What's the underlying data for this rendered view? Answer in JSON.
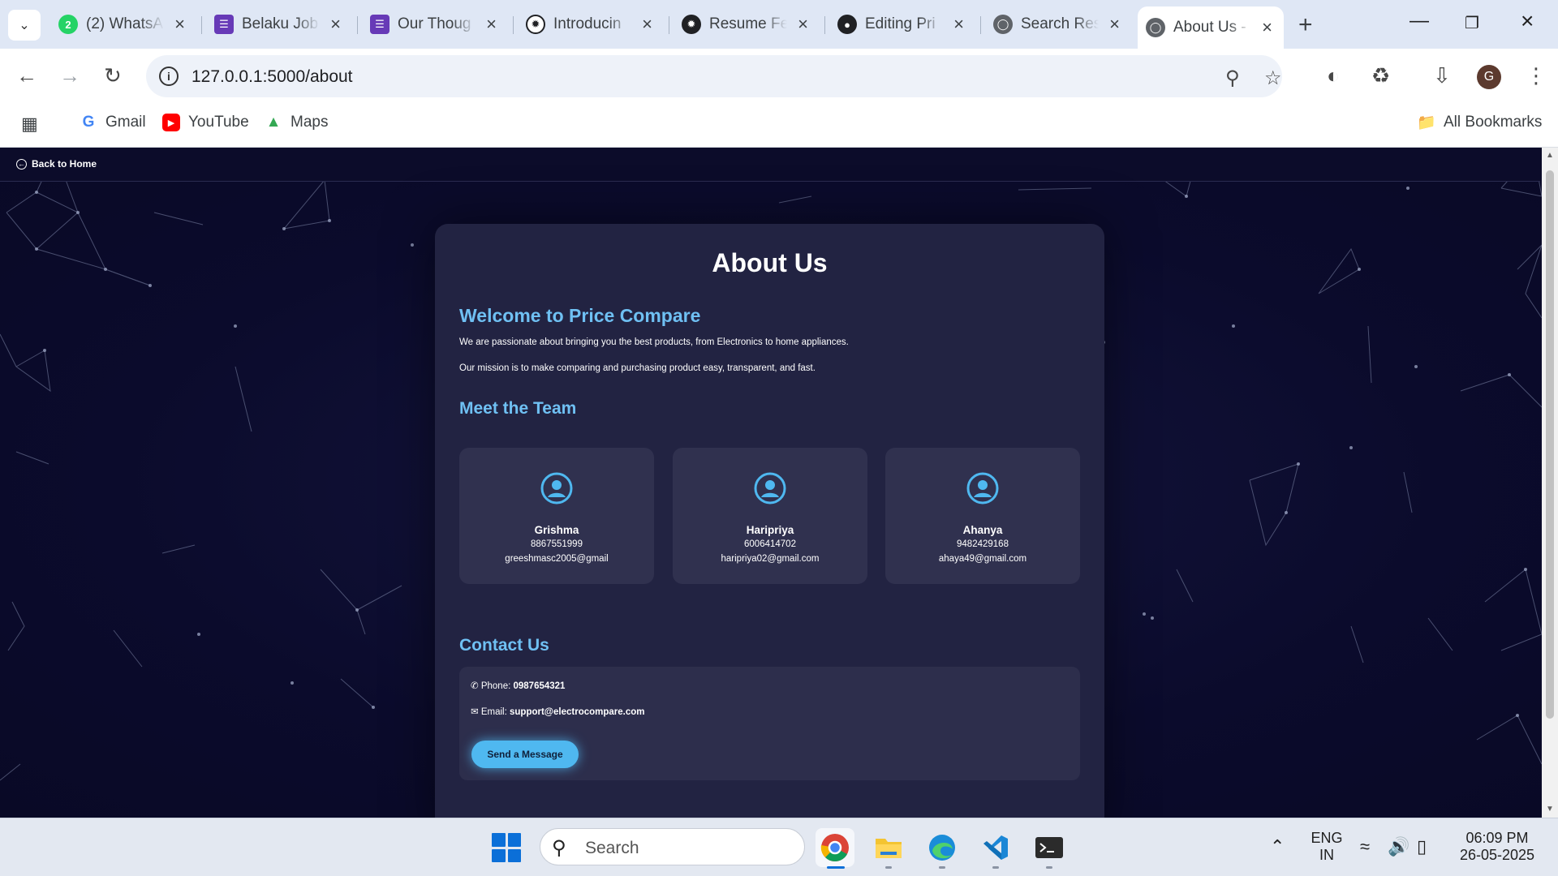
{
  "browser": {
    "tabs": [
      {
        "title": "(2) WhatsA",
        "icon": "whatsapp-icon",
        "color": "#25d366"
      },
      {
        "title": "Belaku Job",
        "icon": "forms-icon",
        "color": "#673ab7"
      },
      {
        "title": "Our Thoug",
        "icon": "forms-icon",
        "color": "#673ab7"
      },
      {
        "title": "Introducin",
        "icon": "openai-icon",
        "color": "#202124"
      },
      {
        "title": "Resume Fe",
        "icon": "openai-icon",
        "color": "#202124"
      },
      {
        "title": "Editing Pri",
        "icon": "github-icon",
        "color": "#202124"
      },
      {
        "title": "Search Res",
        "icon": "globe-icon",
        "color": "#5f6368"
      },
      {
        "title": "About Us -",
        "icon": "globe-icon",
        "color": "#5f6368"
      }
    ],
    "url": "127.0.0.1:5000/about",
    "profile_initial": "G",
    "bookmarks": [
      {
        "label": "Gmail",
        "icon": "google-icon"
      },
      {
        "label": "YouTube",
        "icon": "youtube-icon"
      },
      {
        "label": "Maps",
        "icon": "maps-icon"
      }
    ],
    "all_bookmarks": "All Bookmarks"
  },
  "page": {
    "back_link": "Back to Home",
    "title": "About Us",
    "welcome_heading": "Welcome to Price Compare",
    "welcome_p1": "We are passionate about bringing you the best products, from Electronics to home appliances.",
    "welcome_p2": "Our mission is to make comparing and purchasing product easy, transparent, and fast.",
    "team_heading": "Meet the Team",
    "team": [
      {
        "name": "Grishma",
        "phone": "8867551999",
        "email": "greeshmasc2005@gmail"
      },
      {
        "name": "Haripriya",
        "phone": "6006414702",
        "email": "haripriya02@gmail.com"
      },
      {
        "name": "Ahanya",
        "phone": "9482429168",
        "email": "ahaya49@gmail.com"
      }
    ],
    "contact_heading": "Contact Us",
    "contact": {
      "phone_label": "Phone:",
      "phone": "0987654321",
      "email_label": "Email:",
      "email": "support@electrocompare.com",
      "button": "Send a Message"
    },
    "colors": {
      "accent": "#6fc0f3",
      "button": "#4fb8f0",
      "card": "#222342",
      "background": "#0b0b2c"
    }
  },
  "taskbar": {
    "search_placeholder": "Search",
    "language": "ENG",
    "region": "IN",
    "time": "06:09 PM",
    "date": "26-05-2025"
  }
}
